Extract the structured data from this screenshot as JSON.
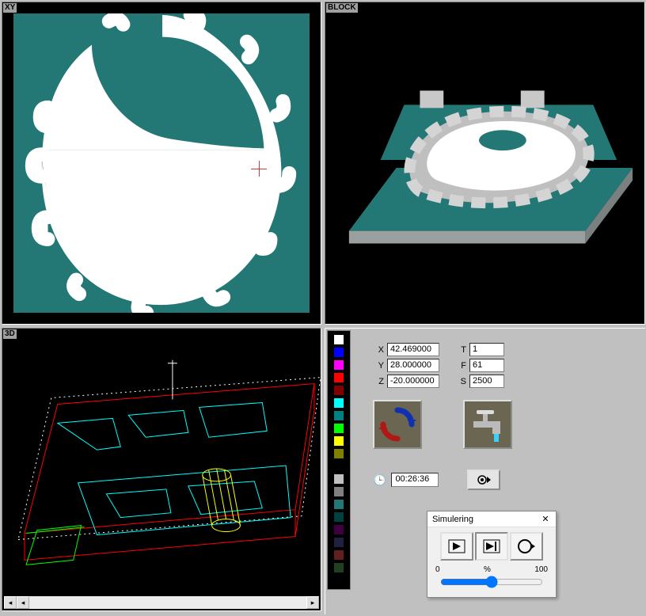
{
  "viewports": {
    "xy": {
      "label": "XY"
    },
    "block": {
      "label": "BLOCK"
    },
    "threeD": {
      "label": "3D"
    }
  },
  "readouts": {
    "x": {
      "label": "X",
      "value": "42.469000"
    },
    "y": {
      "label": "Y",
      "value": "28.000000"
    },
    "z": {
      "label": "Z",
      "value": "-20.000000"
    },
    "t": {
      "label": "T",
      "value": "1"
    },
    "f": {
      "label": "F",
      "value": "61"
    },
    "s": {
      "label": "S",
      "value": "2500"
    }
  },
  "clock": {
    "value": "00:26:36"
  },
  "simulering": {
    "title": "Simulering",
    "scaleMin": "0",
    "scaleMid": "%",
    "scaleMax": "100"
  },
  "palette": [
    "#ffffff",
    "#0000ff",
    "#ff00ff",
    "#ff0000",
    "#800000",
    "#00ffff",
    "#008080",
    "#00ff00",
    "#ffff00",
    "#808000",
    "#000000",
    "#c0c0c0",
    "#808080",
    "#237876",
    "#004040",
    "#400040",
    "#202040",
    "#602020",
    "#204020",
    "#000000"
  ]
}
